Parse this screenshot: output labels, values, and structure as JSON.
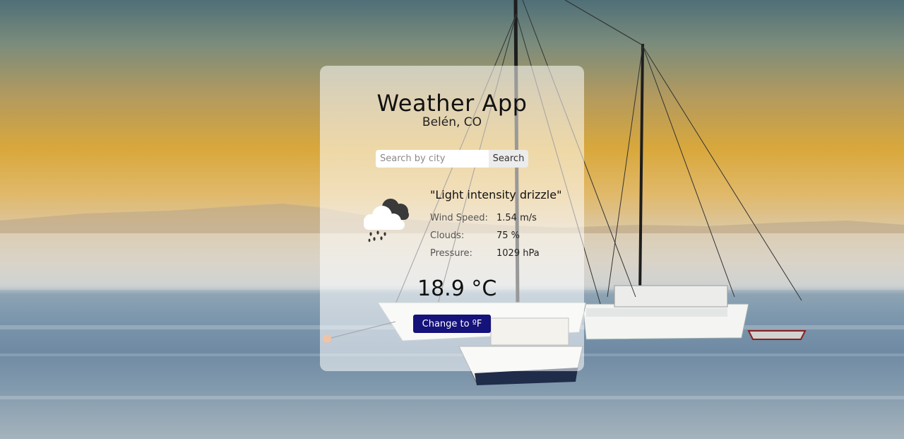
{
  "app": {
    "title": "Weather App",
    "location": "Belén, CO"
  },
  "search": {
    "placeholder": "Search by city",
    "value": "",
    "button_label": "Search"
  },
  "weather": {
    "icon": "rain-cloud-icon",
    "description": "\"Light intensity drizzle\"",
    "stats": [
      {
        "label": "Wind Speed:",
        "value": "1.54 m/s"
      },
      {
        "label": "Clouds:",
        "value": "75 %"
      },
      {
        "label": "Pressure:",
        "value": "1029 hPa"
      }
    ],
    "temperature": "18.9 °C"
  },
  "unit_toggle": {
    "label": "Change to ºF"
  },
  "colors": {
    "button_bg": "#15127a",
    "card_bg": "rgba(255,255,255,0.55)"
  }
}
